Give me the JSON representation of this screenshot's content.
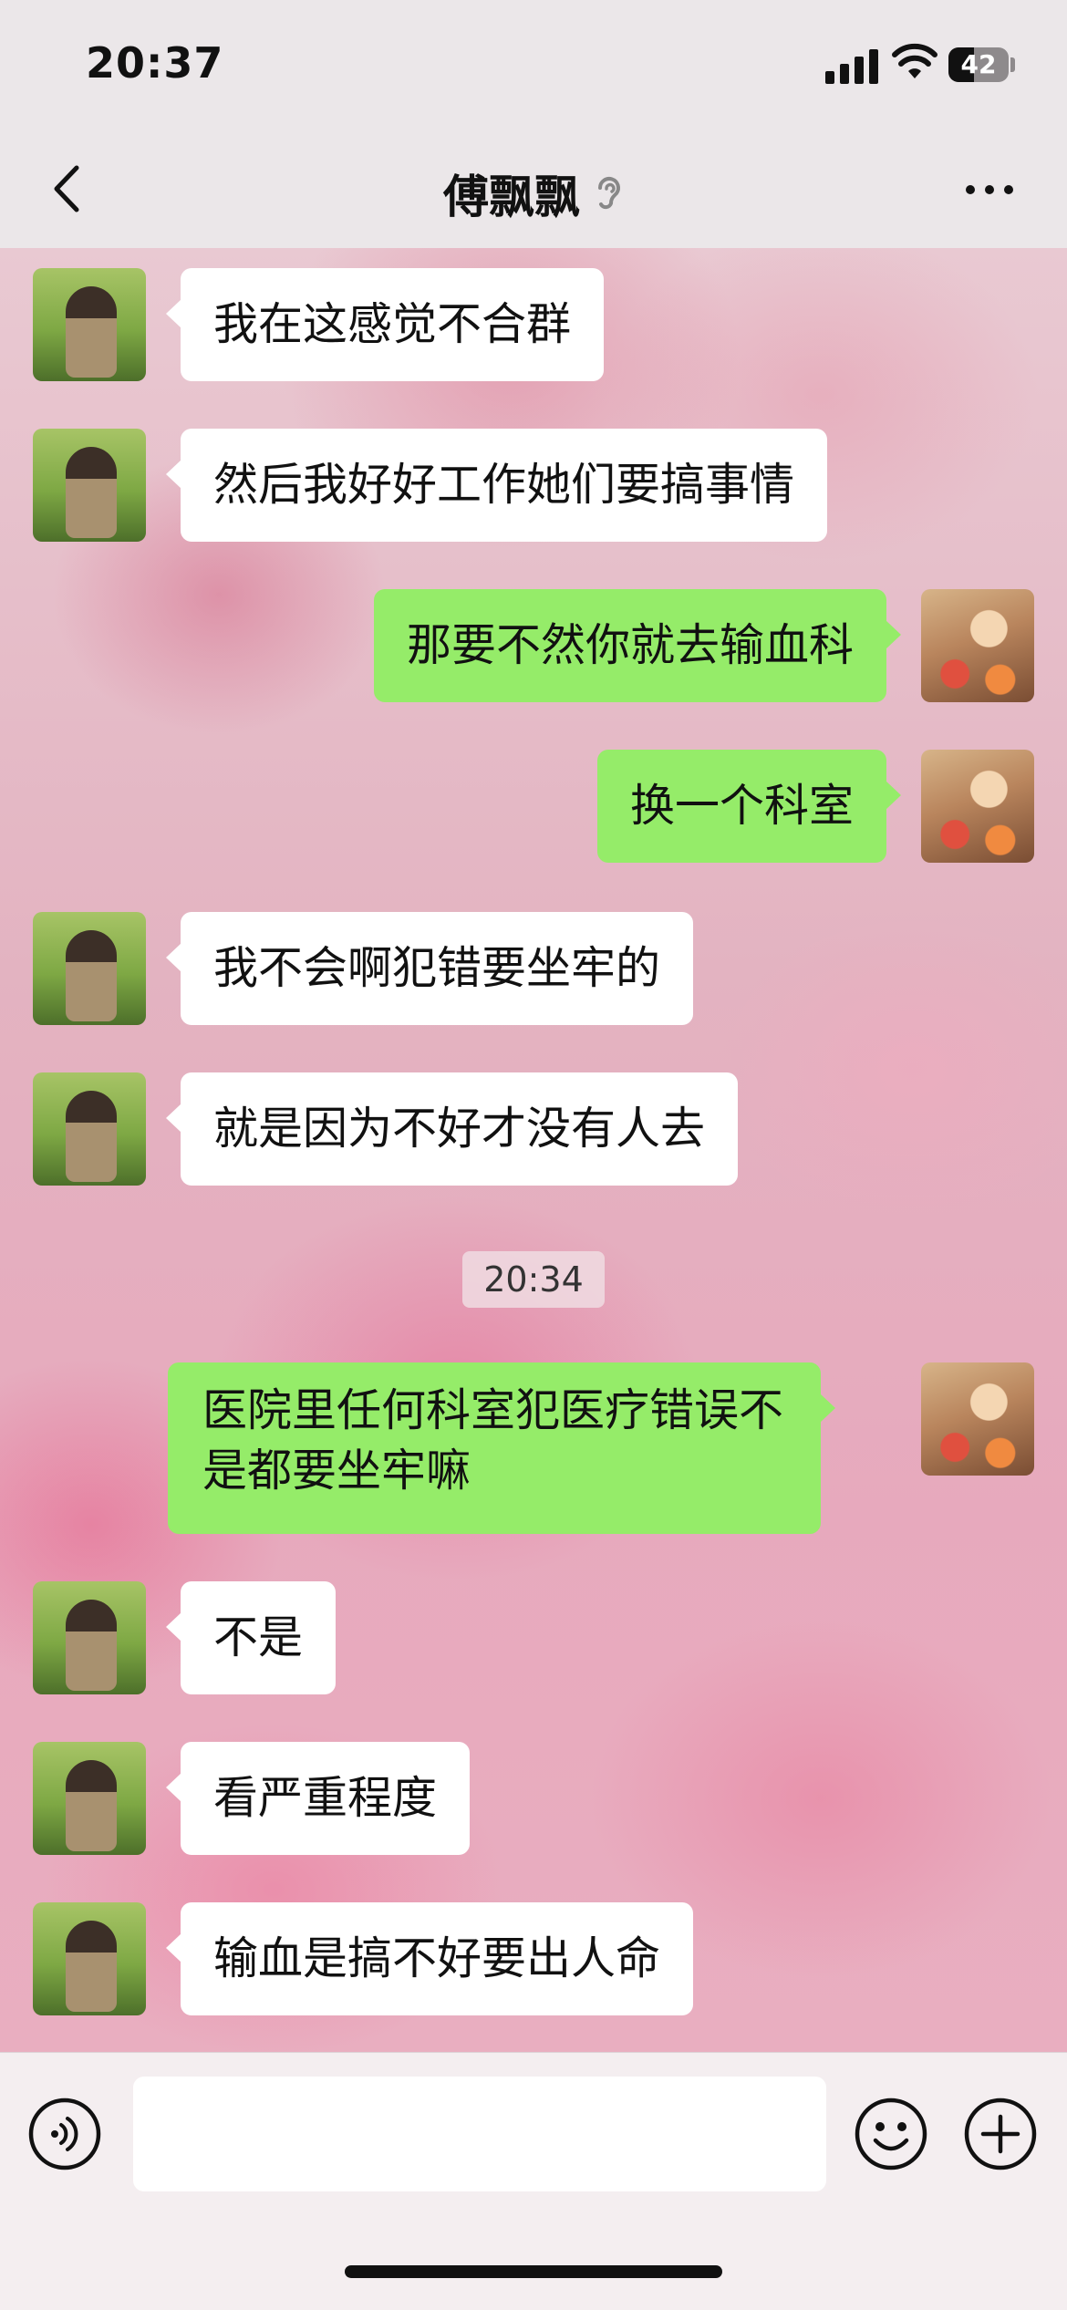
{
  "status_bar": {
    "time": "20:37",
    "battery": "42",
    "battery_fraction": 0.42
  },
  "nav": {
    "title": "傅飘飘"
  },
  "messages": [
    {
      "side": "left",
      "text": "我在这感觉不合群"
    },
    {
      "side": "left",
      "text": "然后我好好工作她们要搞事情"
    },
    {
      "side": "right",
      "text": "那要不然你就去输血科"
    },
    {
      "side": "right",
      "text": "换一个科室"
    },
    {
      "side": "left",
      "text": "我不会啊犯错要坐牢的"
    },
    {
      "side": "left",
      "text": "就是因为不好才没有人去"
    },
    {
      "side": "right",
      "text": "医院里任何科室犯医疗错误不是都要坐牢嘛"
    },
    {
      "side": "left",
      "text": "不是"
    },
    {
      "side": "left",
      "text": "看严重程度"
    },
    {
      "side": "left",
      "text": "输血是搞不好要出人命"
    }
  ],
  "timestamp": "20:34",
  "input": {
    "value": ""
  }
}
